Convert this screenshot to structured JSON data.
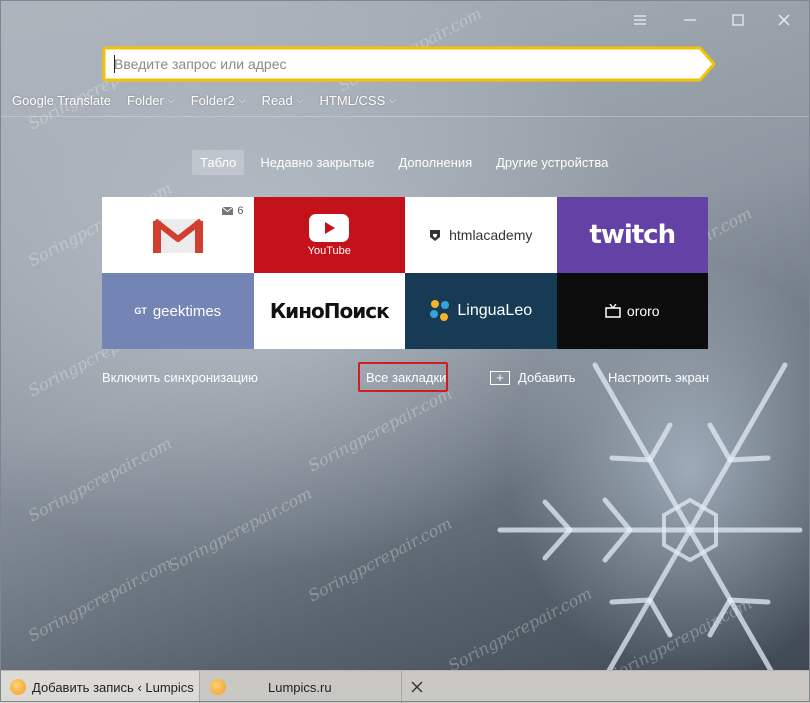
{
  "window": {
    "controls": {
      "menu_icon": "hamburger-icon",
      "minimize_icon": "minimize-icon",
      "maximize_icon": "maximize-icon",
      "close_icon": "close-icon"
    }
  },
  "address_bar": {
    "placeholder": "Введите запрос или адрес",
    "value": "",
    "border_color": "#f5c400"
  },
  "bookmarks_bar": {
    "items": [
      {
        "label": "Google Translate",
        "has_menu": false
      },
      {
        "label": "Folder",
        "has_menu": true
      },
      {
        "label": "Folder2",
        "has_menu": true
      },
      {
        "label": "Read",
        "has_menu": true
      },
      {
        "label": "HTML/CSS",
        "has_menu": true
      }
    ]
  },
  "tabs": [
    {
      "label": "Табло",
      "active": true
    },
    {
      "label": "Недавно закрытые",
      "active": false
    },
    {
      "label": "Дополнения",
      "active": false
    },
    {
      "label": "Другие устройства",
      "active": false
    }
  ],
  "tiles": [
    {
      "name": "gmail",
      "badge_count": "6",
      "color": "#ffffff"
    },
    {
      "name": "youtube",
      "label": "YouTube",
      "color": "#c4121b"
    },
    {
      "name": "htmlacademy",
      "label": "htmlacademy",
      "color": "#ffffff"
    },
    {
      "name": "twitch",
      "label": "twitch",
      "color": "#6441a4"
    },
    {
      "name": "geektimes",
      "prefix": "GT",
      "label": "geektimes",
      "color": "#7384b5"
    },
    {
      "name": "kinopoisk",
      "label": "КиноПоиск",
      "color": "#ffffff"
    },
    {
      "name": "lingualeo",
      "label": "LinguaLeo",
      "color": "#173b54"
    },
    {
      "name": "ororo",
      "label": "ororo",
      "color": "#0c0c0c"
    }
  ],
  "actions": {
    "sync": "Включить синхронизацию",
    "all_bookmarks": "Все закладки",
    "add": "Добавить",
    "customize": "Настроить экран",
    "highlight_color": "#d31b22"
  },
  "watermark": "Soringpcrepair.com",
  "taskbar": {
    "tabs": [
      {
        "label": "Добавить запись ‹ Lumpics",
        "icon": "orange-icon"
      },
      {
        "label": "Lumpics.ru",
        "icon": "orange-icon"
      }
    ],
    "close_icon": "close-icon"
  }
}
